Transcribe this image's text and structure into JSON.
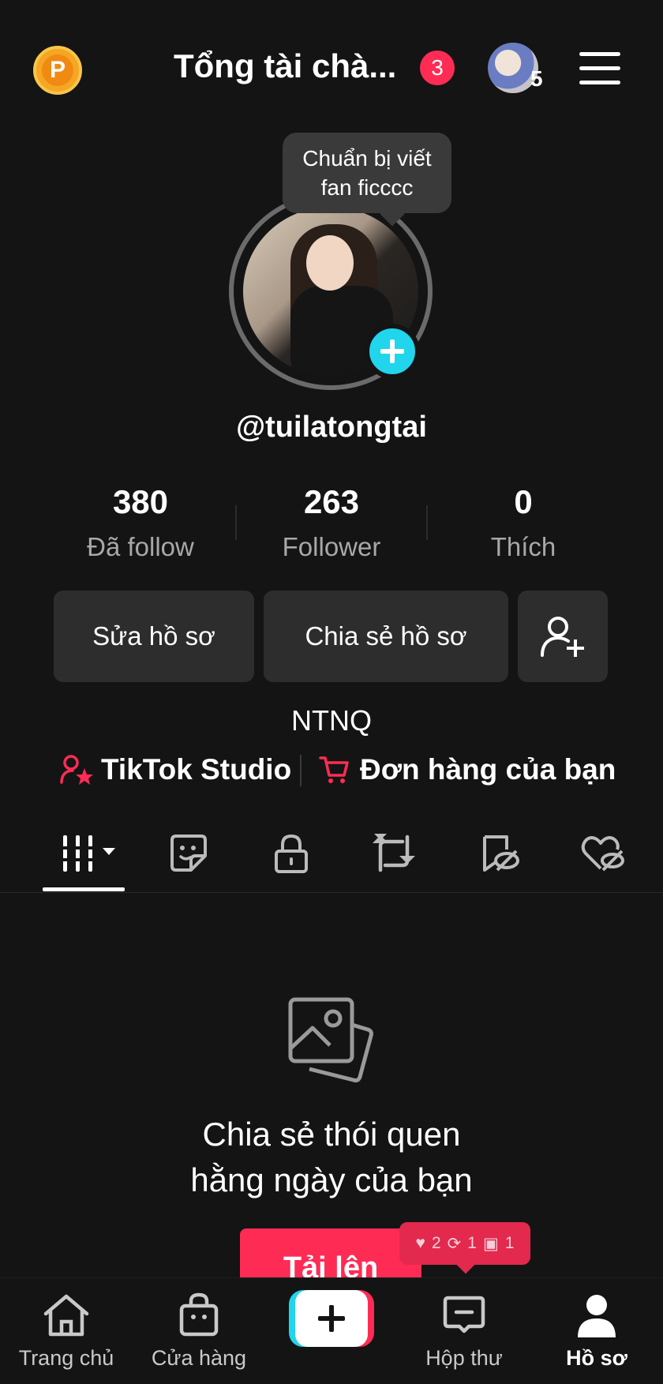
{
  "header": {
    "coin_label": "P",
    "title": "Tổng tài chà...",
    "notification_count": "3",
    "account_count": "5"
  },
  "tooltip": {
    "text": "Chuẩn bị viết fan ficccc"
  },
  "profile": {
    "username": "@tuilatongtai",
    "bio": "NTNQ"
  },
  "stats": [
    {
      "value": "380",
      "label": "Đã follow"
    },
    {
      "value": "263",
      "label": "Follower"
    },
    {
      "value": "0",
      "label": "Thích"
    }
  ],
  "actions": {
    "edit_profile": "Sửa hồ sơ",
    "share_profile": "Chia sẻ hồ sơ"
  },
  "links": {
    "studio": "TikTok Studio",
    "orders": "Đơn hàng của bạn"
  },
  "tabs": [
    "videos-grid-icon",
    "sticker-icon",
    "lock-icon",
    "repost-icon",
    "saved-hidden-icon",
    "liked-hidden-icon"
  ],
  "empty_state": {
    "line1": "Chia sẻ thói quen",
    "line2": "hằng ngày của bạn",
    "upload_label": "Tải lên"
  },
  "activity_toast": {
    "likes": "2",
    "reposts": "1",
    "messages": "1"
  },
  "nav": {
    "home": "Trang chủ",
    "shop": "Cửa hàng",
    "inbox": "Hộp thư",
    "profile": "Hồ sơ"
  },
  "colors": {
    "accent_red": "#fe2c55",
    "accent_cyan": "#20d5ec",
    "background": "#141414",
    "button_bg": "#2d2d2d"
  }
}
